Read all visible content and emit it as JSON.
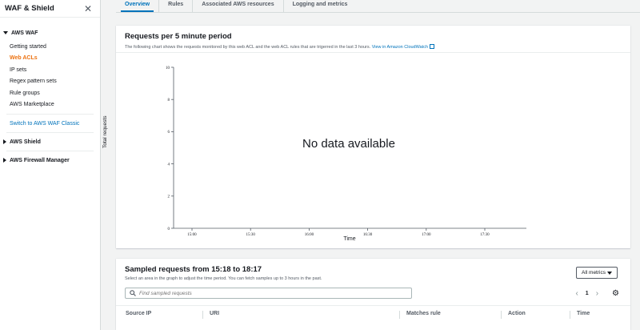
{
  "sidebar": {
    "title": "WAF & Shield",
    "sections": [
      {
        "label": "AWS WAF",
        "expanded": true,
        "items": [
          {
            "label": "Getting started",
            "active": false
          },
          {
            "label": "Web ACLs",
            "active": true
          },
          {
            "label": "IP sets",
            "active": false
          },
          {
            "label": "Regex pattern sets",
            "active": false
          },
          {
            "label": "Rule groups",
            "active": false
          },
          {
            "label": "AWS Marketplace",
            "active": false
          }
        ]
      }
    ],
    "classic_link": "Switch to AWS WAF Classic",
    "shield_label": "AWS Shield",
    "firewall_label": "AWS Firewall Manager"
  },
  "tabs": [
    "Overview",
    "Rules",
    "Associated AWS resources",
    "Logging and metrics"
  ],
  "requests_panel": {
    "title": "Requests per 5 minute period",
    "description": "The following chart shows the requests monitored by this web ACL and the web ACL rules that are trigerred in the last 3 hours.",
    "link_text": "View in Amazon CloudWatch",
    "no_data": "No data available"
  },
  "chart_data": {
    "type": "line",
    "title": "",
    "xlabel": "Time",
    "ylabel": "Total requests",
    "x_ticks": [
      "15:00",
      "15:30",
      "16:00",
      "16:30",
      "17:00",
      "17:30"
    ],
    "y_ticks": [
      "0",
      "2",
      "4",
      "6",
      "8",
      "10"
    ],
    "ylim": [
      0,
      10
    ],
    "series": [],
    "grid": false
  },
  "sampled_panel": {
    "title": "Sampled requests from 15:18 to 18:17",
    "description": "Select an area in the graph to adjust the time period. You can fetch samples up to 3 hours in the past.",
    "metrics_button": "All metrics",
    "search_placeholder": "Find sampled requests",
    "page": "1",
    "columns": [
      "Source IP",
      "URI",
      "Matches rule",
      "Action",
      "Time"
    ]
  },
  "colors": {
    "accent": "#0073bb",
    "active_nav": "#ec7211"
  }
}
